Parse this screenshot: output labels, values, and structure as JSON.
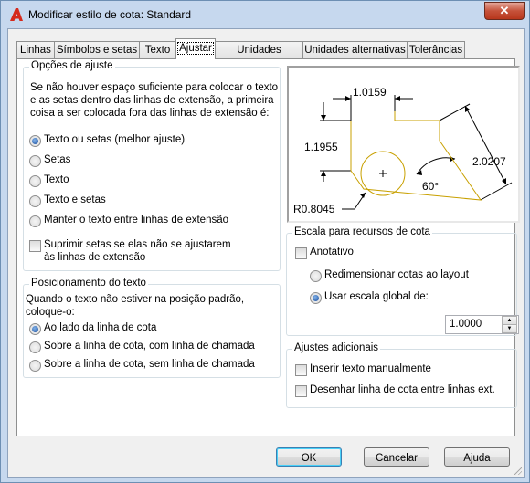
{
  "window": {
    "title": "Modificar estilo de cota: Standard",
    "close_label": "✕",
    "accent": "#c6d8ee"
  },
  "tabs": [
    {
      "label": "Linhas"
    },
    {
      "label": "Símbolos e setas"
    },
    {
      "label": "Texto"
    },
    {
      "label": "Ajustar",
      "active": true
    },
    {
      "label": "Unidades primárias"
    },
    {
      "label": "Unidades alternativas"
    },
    {
      "label": "Tolerâncias"
    }
  ],
  "fit_options": {
    "title": "Opções de ajuste",
    "description": [
      "Se não houver espaço suficiente para colocar o texto",
      "e as setas dentro das linhas de extensão, a primeira",
      "coisa a ser colocada fora das linhas de extensão é:"
    ],
    "radios": [
      {
        "label": "Texto ou setas (melhor ajuste)",
        "selected": true
      },
      {
        "label": "Setas",
        "selected": false
      },
      {
        "label": "Texto",
        "selected": false
      },
      {
        "label": "Texto e setas",
        "selected": false
      },
      {
        "label": "Manter o texto entre linhas de extensão",
        "selected": false
      }
    ],
    "suppress_line1": "Suprimir setas se elas não se ajustarem",
    "suppress_line2": "às linhas de extensão"
  },
  "text_placement": {
    "title": "Posicionamento do texto",
    "description": [
      "Quando o texto não estiver na posição padrão,",
      "coloque-o:"
    ],
    "radios": [
      {
        "label": "Ao lado da linha de cota",
        "selected": true
      },
      {
        "label": "Sobre a linha de cota, com linha de chamada",
        "selected": false
      },
      {
        "label": "Sobre a linha de cota, sem linha de chamada",
        "selected": false
      }
    ]
  },
  "preview": {
    "dim_top": "1.0159",
    "dim_left": "1.1955",
    "dim_right": "2.0207",
    "angle": "60°",
    "radius": "R0.8045",
    "shape_color": "#c8a000"
  },
  "scale": {
    "title": "Escala para recursos de cota",
    "annotative": "Anotativo",
    "radio_layout": "Redimensionar cotas ao layout",
    "radio_global": "Usar escala global de:",
    "global_value": "1.0000"
  },
  "fine_tuning": {
    "title": "Ajustes adicionais",
    "manual_text": "Inserir texto manualmente",
    "draw_line": "Desenhar linha de cota entre linhas ext."
  },
  "buttons": {
    "ok": "OK",
    "cancel": "Cancelar",
    "help": "Ajuda"
  }
}
